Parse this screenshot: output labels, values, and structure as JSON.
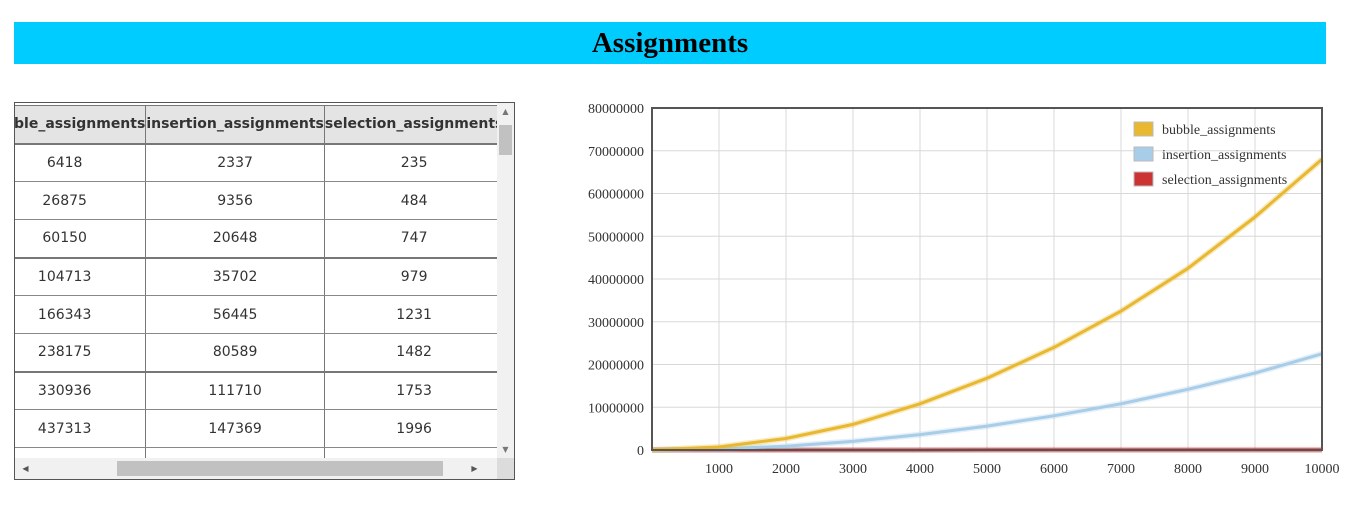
{
  "page": {
    "title": "Assignments"
  },
  "table": {
    "headers": [
      "bubble_assignments",
      "insertion_assignments",
      "selection_assignments"
    ],
    "rows": [
      [
        "6418",
        "2337",
        "235"
      ],
      [
        "26875",
        "9356",
        "484"
      ],
      [
        "60150",
        "20648",
        "747"
      ],
      [
        "104713",
        "35702",
        "979"
      ],
      [
        "166343",
        "56445",
        "1231"
      ],
      [
        "238175",
        "80589",
        "1482"
      ],
      [
        "330936",
        "111710",
        "1753"
      ],
      [
        "437313",
        "147369",
        "1996"
      ],
      [
        "",
        "",
        ""
      ]
    ]
  },
  "chart_data": {
    "type": "line",
    "title": "",
    "xlabel": "",
    "ylabel": "",
    "xlim": [
      0,
      10000
    ],
    "ylim": [
      0,
      80000000
    ],
    "xticks": [
      1000,
      2000,
      3000,
      4000,
      5000,
      6000,
      7000,
      8000,
      9000,
      10000
    ],
    "yticks": [
      0,
      10000000,
      20000000,
      30000000,
      40000000,
      50000000,
      60000000,
      70000000,
      80000000
    ],
    "grid": true,
    "legend_position": "top-right",
    "x": [
      0,
      1000,
      2000,
      3000,
      4000,
      5000,
      6000,
      7000,
      8000,
      9000,
      10000
    ],
    "series": [
      {
        "name": "bubble_assignments",
        "color": "#e8b830",
        "values": [
          0,
          700000,
          2700000,
          6000000,
          10800000,
          16800000,
          24000000,
          32500000,
          42500000,
          54500000,
          68000000
        ]
      },
      {
        "name": "insertion_assignments",
        "color": "#a8cde8",
        "values": [
          0,
          230000,
          900000,
          2000000,
          3600000,
          5600000,
          8000000,
          10800000,
          14200000,
          18000000,
          22500000
        ]
      },
      {
        "name": "selection_assignments",
        "color": "#cc3333",
        "values": [
          0,
          2500,
          5000,
          7500,
          10000,
          12500,
          15000,
          17500,
          20000,
          22500,
          25000
        ]
      }
    ]
  }
}
